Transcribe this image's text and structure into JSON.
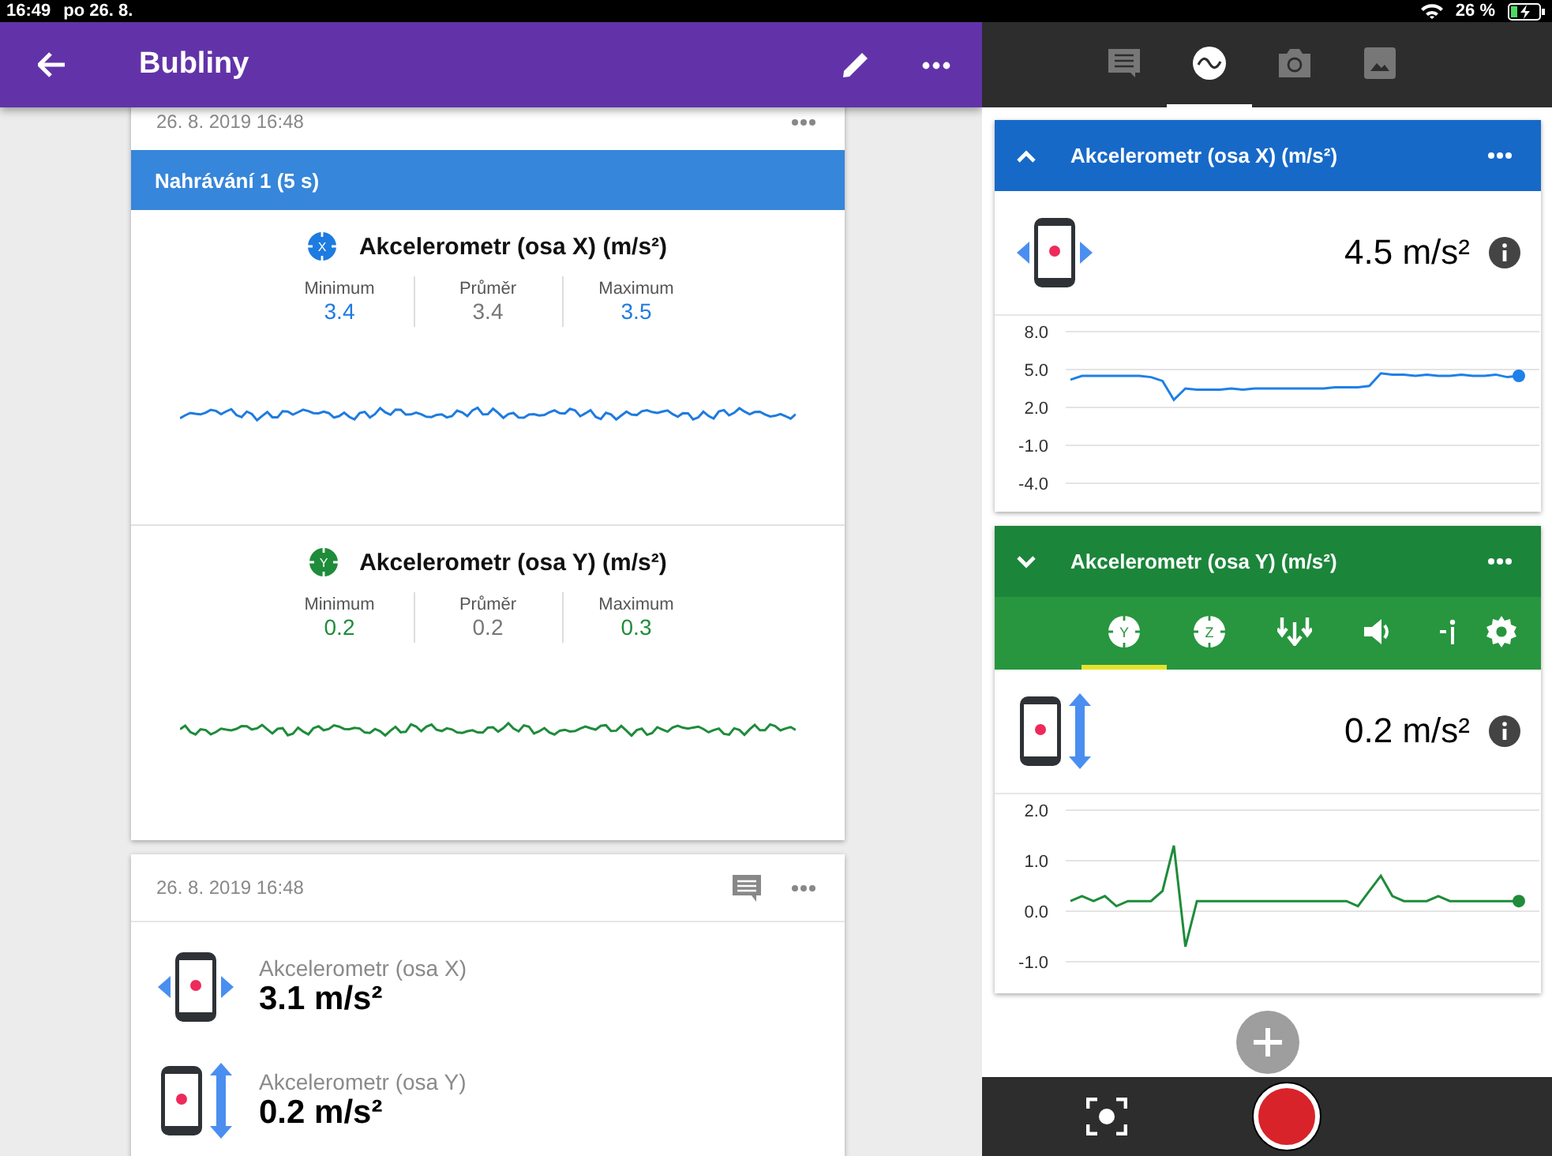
{
  "status_bar": {
    "time": "16:49",
    "date": "po 26. 8.",
    "battery": "26 %"
  },
  "app_bar": {
    "title": "Bubliny"
  },
  "recording_card": {
    "timestamp": "26. 8. 2019 16:48",
    "title": "Nahrávání 1 (5 s)",
    "sensors": [
      {
        "axis": "X",
        "name": "Akcelerometr (osa X) (m/s²)",
        "color": "#1e7be0",
        "stats": [
          {
            "label": "Minimum",
            "value": "3.4",
            "highlight": true
          },
          {
            "label": "Průměr",
            "value": "3.4",
            "highlight": false
          },
          {
            "label": "Maximum",
            "value": "3.5",
            "highlight": true
          }
        ]
      },
      {
        "axis": "Y",
        "name": "Akcelerometr (osa Y) (m/s²)",
        "color": "#1e8c3a",
        "stats": [
          {
            "label": "Minimum",
            "value": "0.2",
            "highlight": true
          },
          {
            "label": "Průměr",
            "value": "0.2",
            "highlight": false
          },
          {
            "label": "Maximum",
            "value": "0.3",
            "highlight": true
          }
        ]
      }
    ]
  },
  "note_card": {
    "timestamp": "26. 8. 2019 16:48",
    "readings": [
      {
        "kind": "x",
        "label": "Akcelerometr (osa X)",
        "value": "3.1 m/s²"
      },
      {
        "kind": "y",
        "label": "Akcelerometr (osa Y)",
        "value": "0.2 m/s²"
      }
    ]
  },
  "tabs": [
    {
      "kind": "notes",
      "selected": false
    },
    {
      "kind": "sensors",
      "selected": true
    },
    {
      "kind": "camera",
      "selected": false
    },
    {
      "kind": "gallery",
      "selected": false
    }
  ],
  "sensor_cards": [
    {
      "kind": "x",
      "title": "Akcelerometr (osa X) (m/s²)",
      "color": "#1769c8",
      "toolbar_open": false,
      "reading": "4.5 m/s²",
      "chart_data": {
        "type": "line",
        "ylim": [
          -4,
          8
        ],
        "yticks": [
          {
            "value": 8,
            "label": "8.0"
          },
          {
            "value": 5,
            "label": "5.0"
          },
          {
            "value": 2,
            "label": "2.0"
          },
          {
            "value": -1,
            "label": "-1.0"
          },
          {
            "value": -4,
            "label": "-4.0"
          }
        ],
        "grid": true,
        "series": [
          {
            "color": "#1e80e8",
            "values": [
              4.2,
              4.5,
              4.5,
              4.5,
              4.5,
              4.5,
              4.5,
              4.4,
              4.1,
              2.6,
              3.5,
              3.4,
              3.4,
              3.4,
              3.5,
              3.4,
              3.5,
              3.5,
              3.5,
              3.5,
              3.5,
              3.5,
              3.5,
              3.6,
              3.6,
              3.6,
              3.7,
              4.7,
              4.6,
              4.6,
              4.5,
              4.6,
              4.5,
              4.5,
              4.6,
              4.5,
              4.5,
              4.6,
              4.4,
              4.5
            ]
          }
        ]
      }
    },
    {
      "kind": "y",
      "title": "Akcelerometr (osa Y) (m/s²)",
      "color": "#1b853a",
      "toolbar_open": true,
      "reading": "0.2 m/s²",
      "chart_data": {
        "type": "line",
        "ylim": [
          -1,
          2
        ],
        "yticks": [
          {
            "value": 2,
            "label": "2.0"
          },
          {
            "value": 1,
            "label": "1.0"
          },
          {
            "value": 0,
            "label": "0.0"
          },
          {
            "value": -1,
            "label": "-1.0"
          }
        ],
        "grid": true,
        "series": [
          {
            "color": "#1e8c3a",
            "values": [
              0.2,
              0.3,
              0.2,
              0.3,
              0.1,
              0.2,
              0.2,
              0.2,
              0.4,
              1.3,
              -0.7,
              0.2,
              0.2,
              0.2,
              0.2,
              0.2,
              0.2,
              0.2,
              0.2,
              0.2,
              0.2,
              0.2,
              0.2,
              0.2,
              0.2,
              0.1,
              0.4,
              0.7,
              0.3,
              0.2,
              0.2,
              0.2,
              0.3,
              0.2,
              0.2,
              0.2,
              0.2,
              0.2,
              0.2,
              0.2
            ]
          }
        ]
      },
      "toolbar": [
        {
          "kind": "y",
          "label": "Y",
          "selected": true
        },
        {
          "kind": "z",
          "label": "Z",
          "selected": false
        },
        {
          "kind": "trigger",
          "selected": false
        },
        {
          "kind": "audio",
          "selected": false
        },
        {
          "kind": "info",
          "selected": false
        },
        {
          "kind": "settings",
          "selected": false
        }
      ]
    }
  ]
}
